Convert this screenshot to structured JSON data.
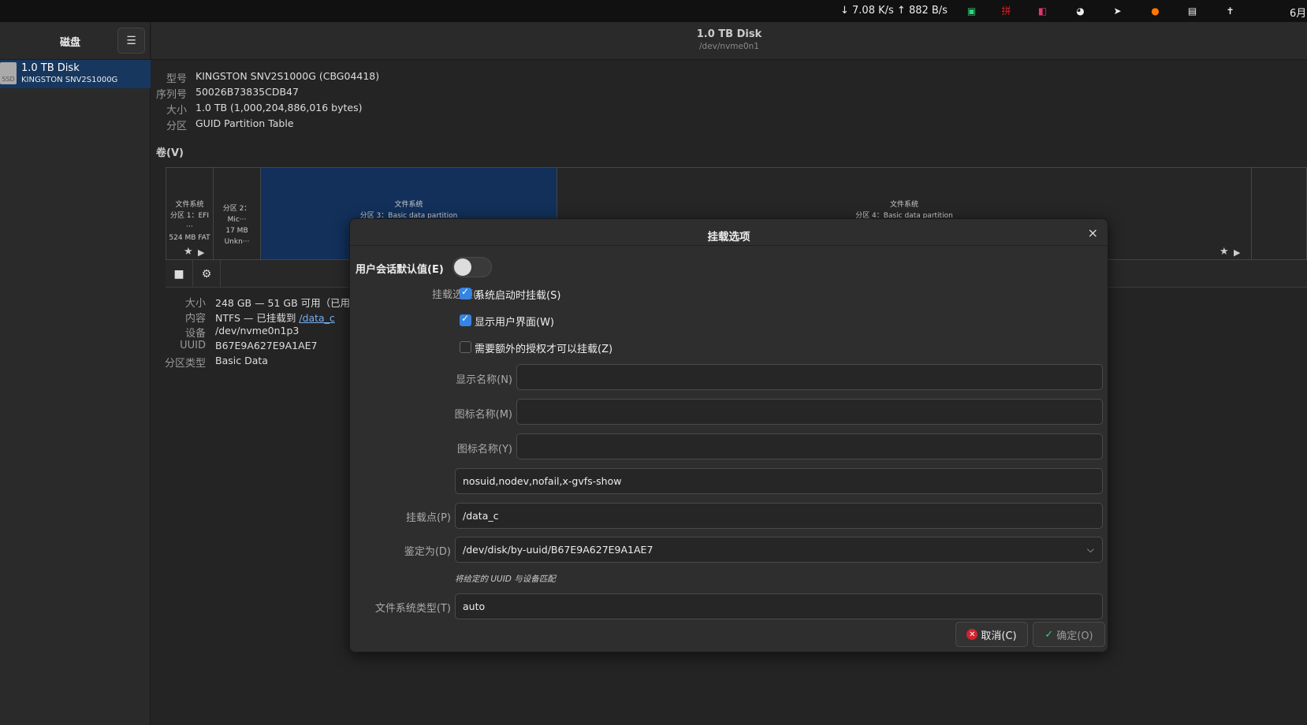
{
  "topbar": {
    "net_speed": "↓ 7.08 K/s ↑ 882 B/s",
    "clock": "6月",
    "tray": [
      {
        "name": "system-monitor-icon",
        "glyph": "▣",
        "color": "#33d17a"
      },
      {
        "name": "input-method-icon",
        "glyph": "拼",
        "color": "#e01b24"
      },
      {
        "name": "app-tray-icon",
        "glyph": "◧",
        "color": "#e5376e"
      },
      {
        "name": "wechat-icon",
        "glyph": "◕",
        "color": "#eeeeee"
      },
      {
        "name": "telegram-icon",
        "glyph": "➤",
        "color": "#eeeeee"
      },
      {
        "name": "cat-icon",
        "glyph": "●",
        "color": "#ff7800"
      },
      {
        "name": "clipboard-icon",
        "glyph": "▤",
        "color": "#eeeeee"
      },
      {
        "name": "accessibility-icon",
        "glyph": "✝",
        "color": "#eeeeee"
      }
    ]
  },
  "sidebar": {
    "title": "磁盘",
    "menu_icon": "☰",
    "disk": {
      "name": "1.0 TB Disk",
      "model": "KINGSTON SNV2S1000G",
      "icon_text": "SSD"
    }
  },
  "header": {
    "title": "1.0 TB Disk",
    "subtitle": "/dev/nvme0n1"
  },
  "disk_info": {
    "model_label": "型号",
    "model": "KINGSTON SNV2S1000G (CBG04418)",
    "serial_label": "序列号",
    "serial": "50026B73835CDB47",
    "size_label": "大小",
    "size": "1.0 TB (1,000,204,886,016 bytes)",
    "partitioning_label": "分区",
    "partitioning": "GUID Partition Table"
  },
  "volumes": {
    "title": "卷(V)",
    "partitions": [
      {
        "lines": [
          "文件系统",
          "分区 1：EFI ···",
          "524 MB FAT"
        ],
        "selected": false
      },
      {
        "lines": [
          "",
          "分区 2：Mic···",
          "17 MB Unkn···"
        ],
        "selected": false
      },
      {
        "lines": [
          "文件系统",
          "分区 3：Basic data partition"
        ],
        "selected": true
      },
      {
        "lines": [
          "文件系统",
          "分区 4：Basic data partition"
        ],
        "selected": false
      },
      {
        "lines": [
          ""
        ],
        "selected": false
      }
    ]
  },
  "volume_details": {
    "size_label": "大小",
    "size": "248 GB — 51 GB 可用（已用",
    "contents_label": "内容",
    "contents_prefix": "NTFS — 已挂载到 ",
    "contents_link": "/data_c",
    "device_label": "设备",
    "device": "/dev/nvme0n1p3",
    "uuid_label": "UUID",
    "uuid": "B67E9A627E9A1AE7",
    "type_label": "分区类型",
    "type": "Basic Data"
  },
  "dialog": {
    "title": "挂载选项",
    "close_glyph": "×",
    "session_defaults_label": "用户会话默认值(E)",
    "session_defaults_on": false,
    "mount_options_label": "挂载选项(I)",
    "mount_at_startup": {
      "label": "系统启动时挂载(S)",
      "checked": true
    },
    "show_in_ui": {
      "label": "显示用户界面(W)",
      "checked": true
    },
    "require_auth": {
      "label": "需要额外的授权才可以挂载(Z)",
      "checked": false
    },
    "display_name_label": "显示名称(N)",
    "display_name_value": "",
    "icon_name_label": "图标名称(M)",
    "icon_name_value": "",
    "symbolic_icon_label": "图标名称(Y)",
    "symbolic_icon_value": "",
    "options_value": "nosuid,nodev,nofail,x-gvfs-show",
    "mount_point_label": "挂载点(P)",
    "mount_point_value": "/data_c",
    "identify_as_label": "鉴定为(D)",
    "identify_as_value": "/dev/disk/by-uuid/B67E9A627E9A1AE7",
    "identify_hint": "将给定的 UUID 与设备匹配",
    "fs_type_label": "文件系统类型(T)",
    "fs_type_value": "auto",
    "cancel_label": "取消(C)",
    "ok_label": "确定(O)"
  }
}
